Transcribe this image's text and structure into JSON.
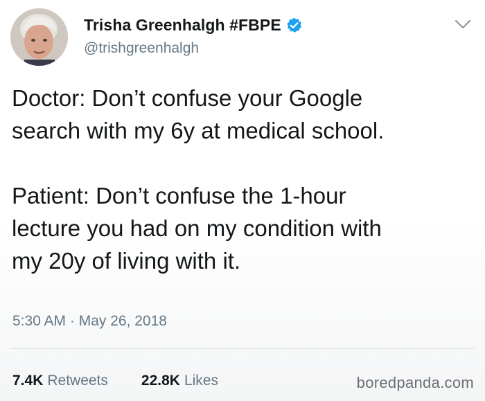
{
  "author": {
    "display_name": "Trisha Greenhalgh #FBPE",
    "handle": "@trishgreenhalgh",
    "verified": true,
    "avatar_icon": "profile-photo"
  },
  "tweet": {
    "paragraphs": [
      "Doctor: Don’t confuse your Google\nsearch with my 6y at medical school.",
      "Patient: Don’t confuse the 1-hour\nlecture you had on my condition with\nmy 20y of living with it."
    ],
    "timestamp": "5:30 AM · May 26, 2018"
  },
  "stats": {
    "retweets_count": "7.4K",
    "retweets_label": "Retweets",
    "likes_count": "22.8K",
    "likes_label": "Likes"
  },
  "watermark": "boredpanda.com",
  "colors": {
    "text": "#14171a",
    "secondary": "#657786",
    "verified_badge": "#1da1f2"
  }
}
